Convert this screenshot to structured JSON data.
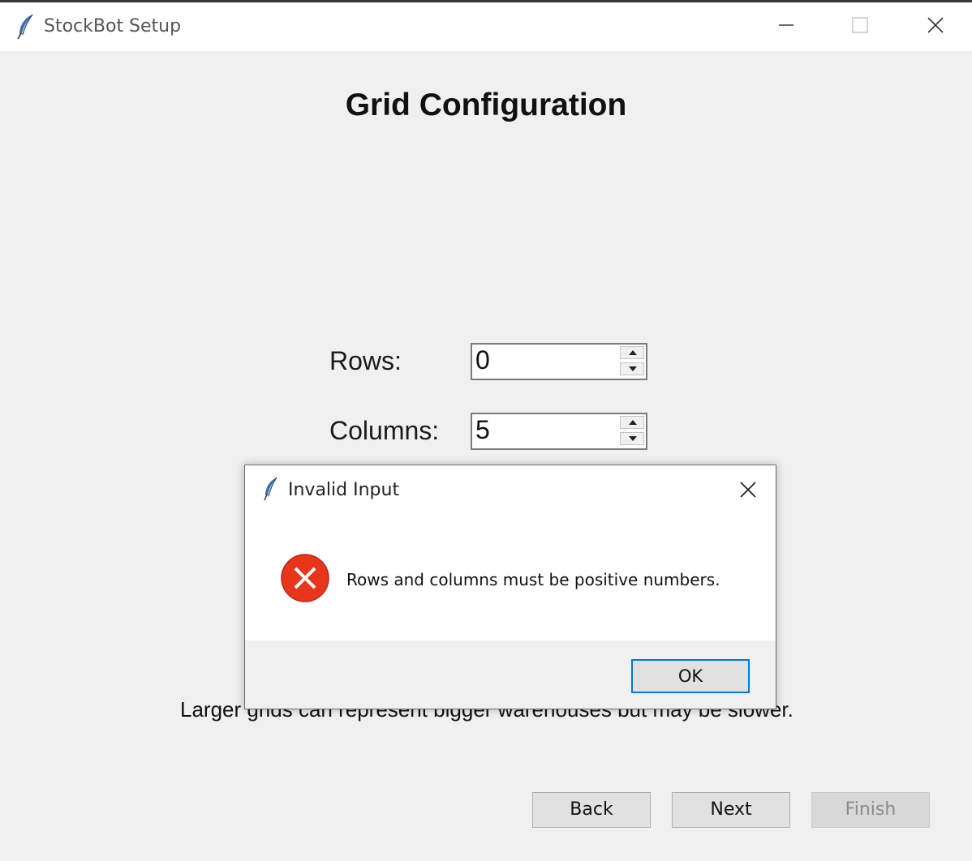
{
  "window": {
    "title": "StockBot Setup",
    "icon": "feather-icon"
  },
  "page": {
    "title": "Grid Configuration",
    "rows_label": "Rows:",
    "rows_value": "0",
    "columns_label": "Columns:",
    "columns_value": "5",
    "hint": "Larger grids can represent bigger warehouses but may be slower."
  },
  "nav": {
    "back": "Back",
    "next": "Next",
    "finish": "Finish"
  },
  "dialog": {
    "title": "Invalid Input",
    "icon": "error-icon",
    "message": "Rows and columns must be positive numbers.",
    "ok": "OK"
  },
  "colors": {
    "error_red": "#e8361c",
    "focus_blue": "#0078d7"
  }
}
